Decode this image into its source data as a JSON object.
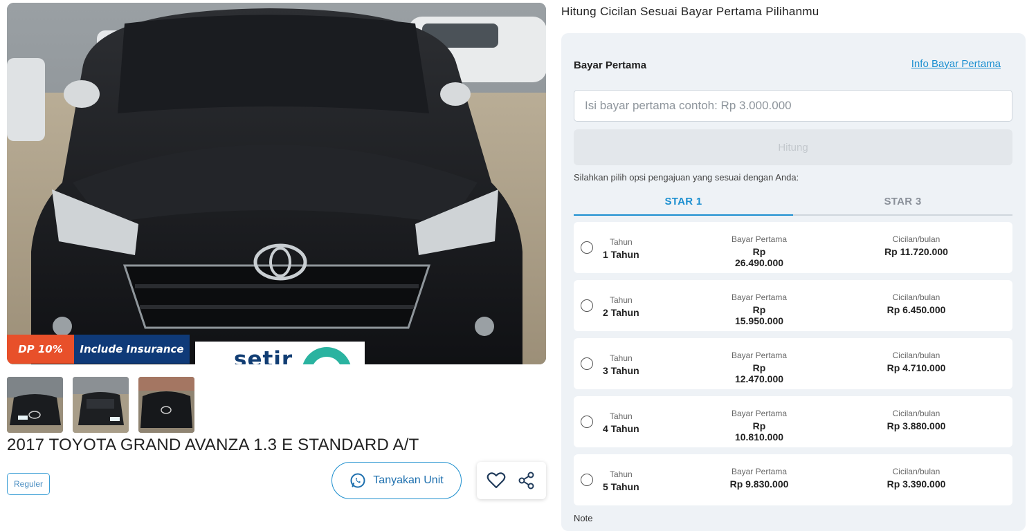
{
  "listing": {
    "badges": {
      "dp": "DP 10%",
      "insurance": "Include Insurance"
    },
    "brand_text": "setir",
    "title": "2017 TOYOTA GRAND AVANZA 1.3 E STANDARD A/T",
    "tag": "Reguler",
    "ask_button": "Tanyakan Unit",
    "thumbnail_count": 3
  },
  "calculator": {
    "section_title": "Hitung Cicilan Sesuai Bayar Pertama Pilihanmu",
    "bayar_label": "Bayar Pertama",
    "info_link": "Info Bayar Pertama",
    "input_placeholder": "Isi bayar pertama contoh: Rp 3.000.000",
    "hitung_button": "Hitung",
    "opsi_text": "Silahkan pilih opsi pengajuan yang sesuai dengan Anda:",
    "tabs": [
      {
        "label": "STAR 1",
        "active": true
      },
      {
        "label": "STAR 3",
        "active": false
      }
    ],
    "col_headers": {
      "tahun": "Tahun",
      "bayar": "Bayar Pertama",
      "cicilan": "Cicilan/bulan"
    },
    "options": [
      {
        "tahun": "1 Tahun",
        "bayar": "Rp 26.490.000",
        "cicilan": "Rp 11.720.000"
      },
      {
        "tahun": "2 Tahun",
        "bayar": "Rp 15.950.000",
        "cicilan": "Rp 6.450.000"
      },
      {
        "tahun": "3 Tahun",
        "bayar": "Rp 12.470.000",
        "cicilan": "Rp 4.710.000"
      },
      {
        "tahun": "4 Tahun",
        "bayar": "Rp 10.810.000",
        "cicilan": "Rp 3.880.000"
      },
      {
        "tahun": "5 Tahun",
        "bayar": "Rp 9.830.000",
        "cicilan": "Rp 3.390.000"
      }
    ],
    "note": "Note"
  },
  "colors": {
    "accent": "#1b8fd0",
    "dp_badge": "#e8502a",
    "insurance_badge": "#0f3a78",
    "panel_bg": "#eef2f6"
  }
}
